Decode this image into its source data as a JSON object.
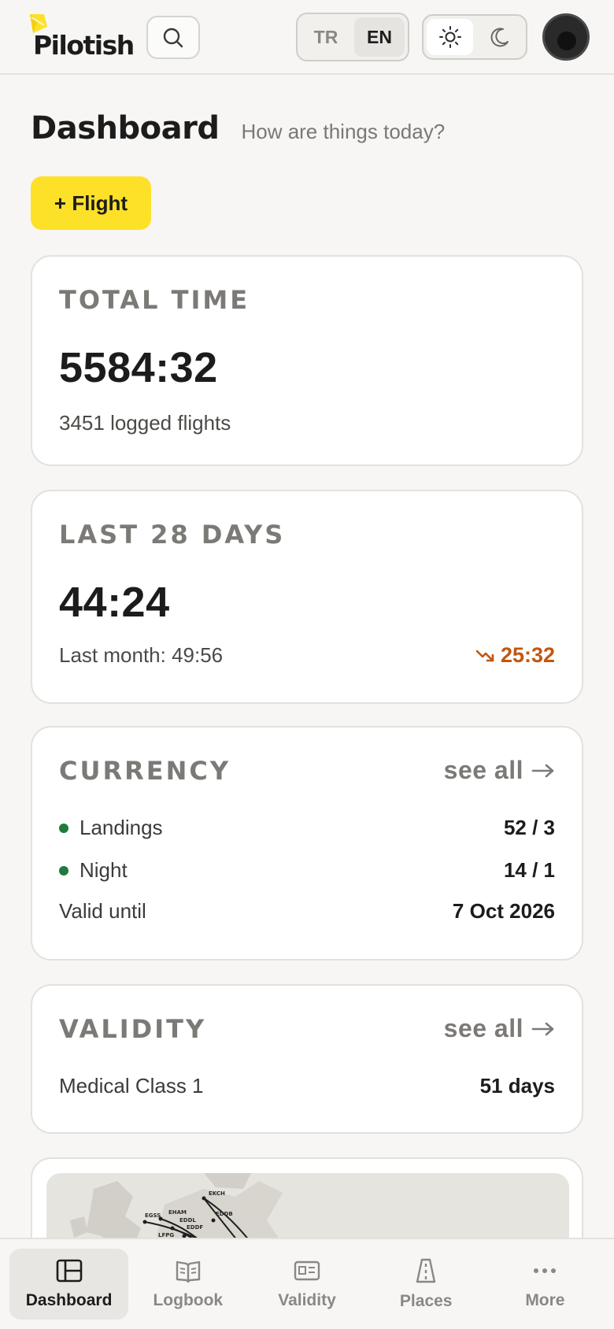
{
  "header": {
    "logo_text": "Pilotish",
    "search_icon": "search-icon",
    "languages": [
      {
        "label": "TR",
        "active": false
      },
      {
        "label": "EN",
        "active": true
      }
    ],
    "themes": [
      {
        "icon": "sun-icon",
        "active": true
      },
      {
        "icon": "moon-icon",
        "active": false
      }
    ]
  },
  "page": {
    "title": "Dashboard",
    "subtitle": "How are things today?",
    "add_flight_label": "+ Flight"
  },
  "total_time": {
    "label": "TOTAL TIME",
    "value": "5584:32",
    "sub": "3451 logged flights"
  },
  "last_28": {
    "label": "LAST 28 DAYS",
    "value": "44:24",
    "sub": "Last month: 49:56",
    "trend_value": "25:32",
    "trend_icon": "trend-down-icon",
    "trend_color": "#c2560f"
  },
  "currency": {
    "label": "CURRENCY",
    "see_all": "see all",
    "rows": [
      {
        "label": "Landings",
        "value": "52 / 3",
        "status_color": "#1f7a3c"
      },
      {
        "label": "Night",
        "value": "14 / 1",
        "status_color": "#1f7a3c"
      }
    ],
    "valid_label": "Valid until",
    "valid_value": "7 Oct 2026"
  },
  "validity": {
    "label": "VALIDITY",
    "see_all": "see all",
    "rows": [
      {
        "label": "Medical Class 1",
        "value": "51 days"
      }
    ]
  },
  "map": {
    "airports": [
      "EKCH",
      "EGSS",
      "EHAM",
      "EDDL",
      "EDDF",
      "LFPG",
      "EDDB"
    ]
  },
  "nav": [
    {
      "label": "Dashboard",
      "icon": "dashboard-icon",
      "active": true
    },
    {
      "label": "Logbook",
      "icon": "book-icon",
      "active": false
    },
    {
      "label": "Validity",
      "icon": "id-card-icon",
      "active": false
    },
    {
      "label": "Places",
      "icon": "road-icon",
      "active": false
    },
    {
      "label": "More",
      "icon": "more-icon",
      "active": false
    }
  ],
  "colors": {
    "accent": "#fde129",
    "background": "#f7f6f4",
    "card": "#ffffff"
  }
}
